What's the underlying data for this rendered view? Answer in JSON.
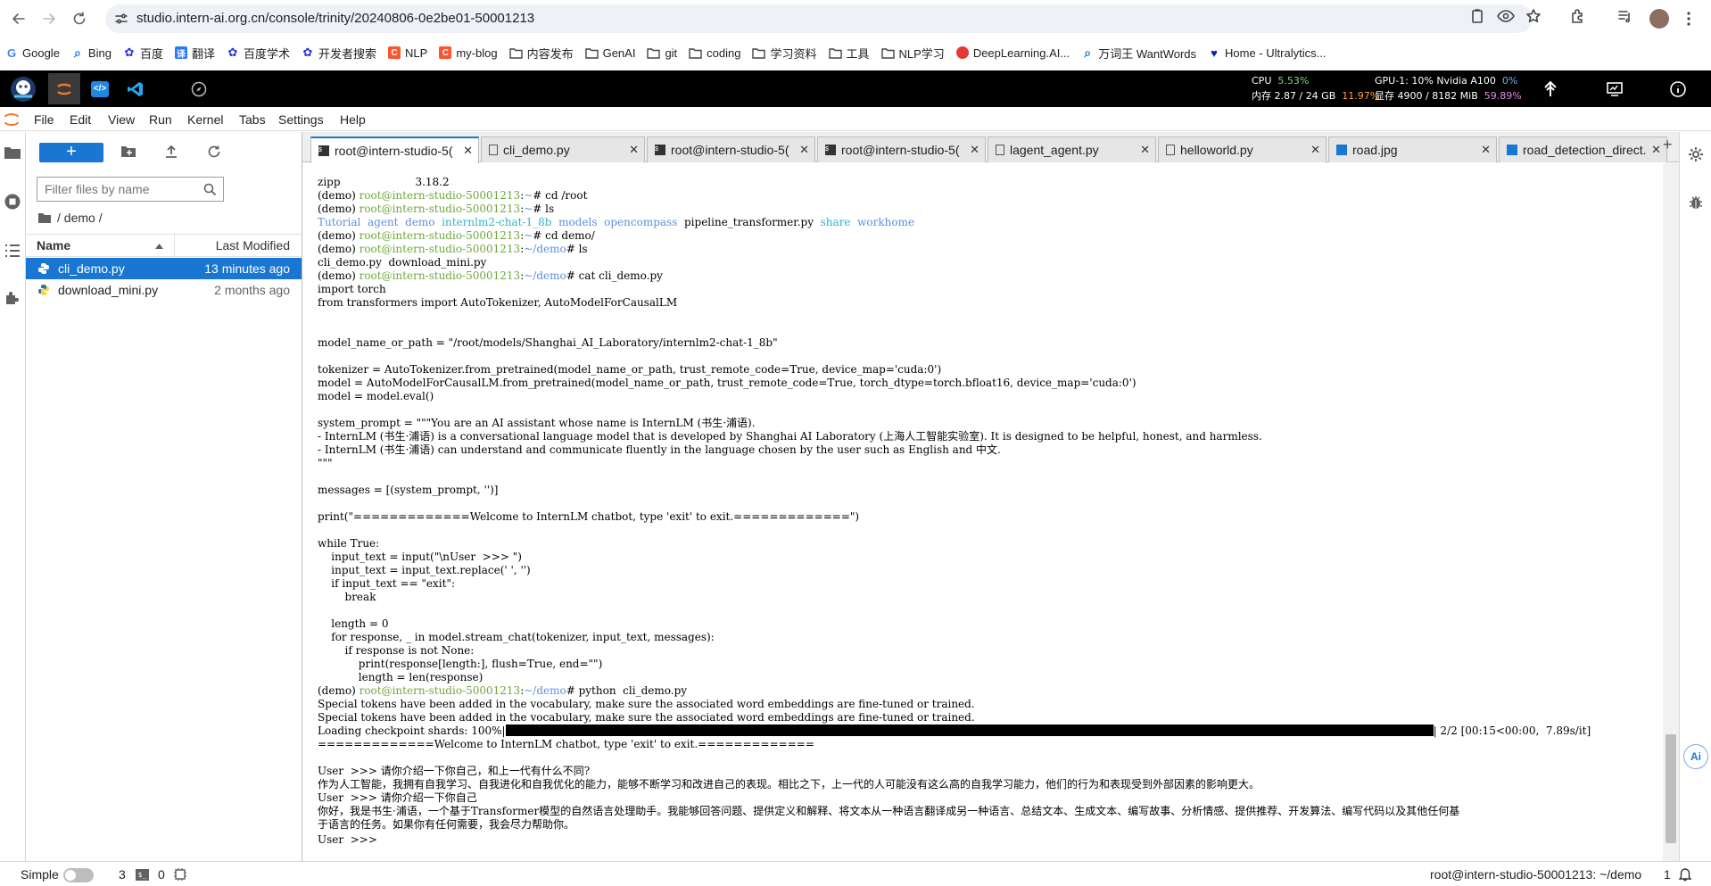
{
  "browser": {
    "url": "studio.intern-ai.org.cn/console/trinity/20240806-0e2be01-50001213",
    "bookmarks": [
      {
        "label": "Google",
        "icon": "google-icon",
        "color": "#4285f4"
      },
      {
        "label": "Bing",
        "icon": "search-icon",
        "color": "#1a73e8"
      },
      {
        "label": "百度",
        "icon": "baidu-icon",
        "color": "#2932e1"
      },
      {
        "label": "翻译",
        "icon": "translate-icon",
        "color": "#2979ff"
      },
      {
        "label": "百度学术",
        "icon": "baidu-icon",
        "color": "#2932e1"
      },
      {
        "label": "开发者搜索",
        "icon": "dev-search-icon",
        "color": "#2932e1"
      },
      {
        "label": "NLP",
        "icon": "csdn-icon",
        "color": "#fc5531"
      },
      {
        "label": "my-blog",
        "icon": "csdn-icon",
        "color": "#fc5531"
      },
      {
        "label": "内容发布",
        "icon": "folder-icon",
        "color": ""
      },
      {
        "label": "GenAI",
        "icon": "folder-icon",
        "color": ""
      },
      {
        "label": "git",
        "icon": "folder-icon",
        "color": ""
      },
      {
        "label": "coding",
        "icon": "folder-icon",
        "color": ""
      },
      {
        "label": "学习资料",
        "icon": "folder-icon",
        "color": ""
      },
      {
        "label": "工具",
        "icon": "folder-icon",
        "color": ""
      },
      {
        "label": "NLP学习",
        "icon": "folder-icon",
        "color": ""
      },
      {
        "label": "DeepLearning.AI...",
        "icon": "deeplearning-icon",
        "color": "#e53935"
      },
      {
        "label": "万词王 WantWords",
        "icon": "search-icon",
        "color": "#1a73e8"
      },
      {
        "label": "Home - Ultralytics...",
        "icon": "ultralytics-icon",
        "color": "#0b23a9"
      }
    ]
  },
  "resources": {
    "cpu_label": "CPU",
    "cpu_value": "5.53%",
    "mem_label": "内存 2.87 / 24 GB",
    "mem_value": "11.97%",
    "gpu_label": "GPU-1: 10% Nvidia A100",
    "gpu_value": "0%",
    "vram_label": "显存 4900 / 8182 MiB",
    "vram_value": "59.89%"
  },
  "menu": [
    "File",
    "Edit",
    "View",
    "Run",
    "Kernel",
    "Tabs",
    "Settings",
    "Help"
  ],
  "filebrowser": {
    "new_label": "+",
    "filter_placeholder": "Filter files by name",
    "breadcrumb": "/ demo /",
    "col_name": "Name",
    "col_modified": "Last Modified",
    "files": [
      {
        "name": "cli_demo.py",
        "modified": "13 minutes ago",
        "selected": true
      },
      {
        "name": "download_mini.py",
        "modified": "2 months ago",
        "selected": false
      }
    ]
  },
  "tabs": [
    {
      "label": "root@intern-studio-5(",
      "type": "terminal",
      "active": true
    },
    {
      "label": "cli_demo.py",
      "type": "file",
      "active": false
    },
    {
      "label": "root@intern-studio-5(",
      "type": "terminal",
      "active": false
    },
    {
      "label": "root@intern-studio-5(",
      "type": "terminal",
      "active": false
    },
    {
      "label": "lagent_agent.py",
      "type": "file",
      "active": false
    },
    {
      "label": "helloworld.py",
      "type": "file",
      "active": false
    },
    {
      "label": "road.jpg",
      "type": "image",
      "active": false
    },
    {
      "label": "road_detection_direct.",
      "type": "image",
      "active": false
    }
  ],
  "new_tab_label": "+",
  "terminal": {
    "lines": [
      [
        {
          "t": "zipp                      3.18.2"
        }
      ],
      [
        {
          "t": "(demo) "
        },
        {
          "t": "root@intern-studio-50001213",
          "c": "g"
        },
        {
          "t": ":"
        },
        {
          "t": "~",
          "c": "b"
        },
        {
          "t": "# cd /root"
        }
      ],
      [
        {
          "t": "(demo) "
        },
        {
          "t": "root@intern-studio-50001213",
          "c": "g"
        },
        {
          "t": ":"
        },
        {
          "t": "~",
          "c": "b"
        },
        {
          "t": "# ls"
        }
      ],
      [
        {
          "t": "Tutorial",
          "c": "b"
        },
        {
          "t": "  "
        },
        {
          "t": "agent",
          "c": "b"
        },
        {
          "t": "  "
        },
        {
          "t": "demo",
          "c": "b"
        },
        {
          "t": "  "
        },
        {
          "t": "internlm2-chat-1_8b",
          "c": "c"
        },
        {
          "t": "  "
        },
        {
          "t": "models",
          "c": "b"
        },
        {
          "t": "  "
        },
        {
          "t": "opencompass",
          "c": "b"
        },
        {
          "t": "  pipeline_transformer.py  "
        },
        {
          "t": "share",
          "c": "c"
        },
        {
          "t": "  "
        },
        {
          "t": "workhome",
          "c": "b"
        }
      ],
      [
        {
          "t": "(demo) "
        },
        {
          "t": "root@intern-studio-50001213",
          "c": "g"
        },
        {
          "t": ":"
        },
        {
          "t": "~",
          "c": "b"
        },
        {
          "t": "# cd demo/"
        }
      ],
      [
        {
          "t": "(demo) "
        },
        {
          "t": "root@intern-studio-50001213",
          "c": "g"
        },
        {
          "t": ":"
        },
        {
          "t": "~/demo",
          "c": "b"
        },
        {
          "t": "# ls"
        }
      ],
      [
        {
          "t": "cli_demo.py  download_mini.py"
        }
      ],
      [
        {
          "t": "(demo) "
        },
        {
          "t": "root@intern-studio-50001213",
          "c": "g"
        },
        {
          "t": ":"
        },
        {
          "t": "~/demo",
          "c": "b"
        },
        {
          "t": "# cat cli_demo.py"
        }
      ],
      [
        {
          "t": "import torch"
        }
      ],
      [
        {
          "t": "from transformers import AutoTokenizer, AutoModelForCausalLM"
        }
      ],
      [
        {
          "t": ""
        }
      ],
      [
        {
          "t": ""
        }
      ],
      [
        {
          "t": "model_name_or_path = \"/root/models/Shanghai_AI_Laboratory/internlm2-chat-1_8b\""
        }
      ],
      [
        {
          "t": ""
        }
      ],
      [
        {
          "t": "tokenizer = AutoTokenizer.from_pretrained(model_name_or_path, trust_remote_code=True, device_map='cuda:0')"
        }
      ],
      [
        {
          "t": "model = AutoModelForCausalLM.from_pretrained(model_name_or_path, trust_remote_code=True, torch_dtype=torch.bfloat16, device_map='cuda:0')"
        }
      ],
      [
        {
          "t": "model = model.eval()"
        }
      ],
      [
        {
          "t": ""
        }
      ],
      [
        {
          "t": "system_prompt = \"\"\"You are an AI assistant whose name is InternLM (书生·浦语)."
        }
      ],
      [
        {
          "t": "- InternLM (书生·浦语) is a conversational language model that is developed by Shanghai AI Laboratory (上海人工智能实验室). It is designed to be helpful, honest, and harmless."
        }
      ],
      [
        {
          "t": "- InternLM (书生·浦语) can understand and communicate fluently in the language chosen by the user such as English and 中文."
        }
      ],
      [
        {
          "t": "\"\"\""
        }
      ],
      [
        {
          "t": ""
        }
      ],
      [
        {
          "t": "messages = [(system_prompt, '')]"
        }
      ],
      [
        {
          "t": ""
        }
      ],
      [
        {
          "t": "print(\"=============Welcome to InternLM chatbot, type 'exit' to exit.=============\")"
        }
      ],
      [
        {
          "t": ""
        }
      ],
      [
        {
          "t": "while True:"
        }
      ],
      [
        {
          "t": "    input_text = input(\"\\nUser  >>> \")"
        }
      ],
      [
        {
          "t": "    input_text = input_text.replace(' ', '')"
        }
      ],
      [
        {
          "t": "    if input_text == \"exit\":"
        }
      ],
      [
        {
          "t": "        break"
        }
      ],
      [
        {
          "t": ""
        }
      ],
      [
        {
          "t": "    length = 0"
        }
      ],
      [
        {
          "t": "    for response, _ in model.stream_chat(tokenizer, input_text, messages):"
        }
      ],
      [
        {
          "t": "        if response is not None:"
        }
      ],
      [
        {
          "t": "            print(response[length:], flush=True, end=\"\")"
        }
      ],
      [
        {
          "t": "            length = len(response)"
        }
      ],
      [
        {
          "t": "(demo) "
        },
        {
          "t": "root@intern-studio-50001213",
          "c": "g"
        },
        {
          "t": ":"
        },
        {
          "t": "~/demo",
          "c": "b"
        },
        {
          "t": "# python  cli_demo.py"
        }
      ],
      [
        {
          "t": "Special tokens have been added in the vocabulary, make sure the associated word embeddings are fine-tuned or trained."
        }
      ],
      [
        {
          "t": "Special tokens have been added in the vocabulary, make sure the associated word embeddings are fine-tuned or trained."
        }
      ],
      [
        {
          "t": "Loading checkpoint shards: 100%|"
        },
        {
          "t": "",
          "bar": true
        },
        {
          "t": "| 2/2 [00:15<00:00,  7.89s/it]"
        }
      ],
      [
        {
          "t": "=============Welcome to InternLM chatbot, type 'exit' to exit.============="
        }
      ],
      [
        {
          "t": ""
        }
      ],
      [
        {
          "t": "User  >>> 请你介绍一下你自己，和上一代有什么不同?"
        }
      ],
      [
        {
          "t": "作为人工智能，我拥有自我学习、自我进化和自我优化的能力，能够不断学习和改进自己的表现。相比之下，上一代的人可能没有这么高的自我学习能力，他们的行为和表现受到外部因素的影响更大。"
        }
      ],
      [
        {
          "t": "User  >>> 请你介绍一下你自己"
        }
      ],
      [
        {
          "t": "你好，我是书生·浦语，一个基于Transformer模型的自然语言处理助手。我能够回答问题、提供定义和解释、将文本从一种语言翻译成另一种语言、总结文本、生成文本、编写故事、分析情感、提供推荐、开发算法、编写代码以及其他任何基"
        }
      ],
      [
        {
          "t": "于语言的任务。如果你有任何需要，我会尽力帮助你。"
        }
      ],
      [
        {
          "t": "User  >>> "
        }
      ]
    ]
  },
  "status": {
    "mode_label": "Simple",
    "terminals_count": "3",
    "kernels_count": "0",
    "right_text": "root@intern-studio-50001213: ~/demo",
    "notif_count": "1"
  },
  "colors": {
    "accent": "#1976d2",
    "prompt_green": "#6fa83c",
    "dir_blue": "#5d8fe0",
    "cyan": "#2fb4c9"
  }
}
